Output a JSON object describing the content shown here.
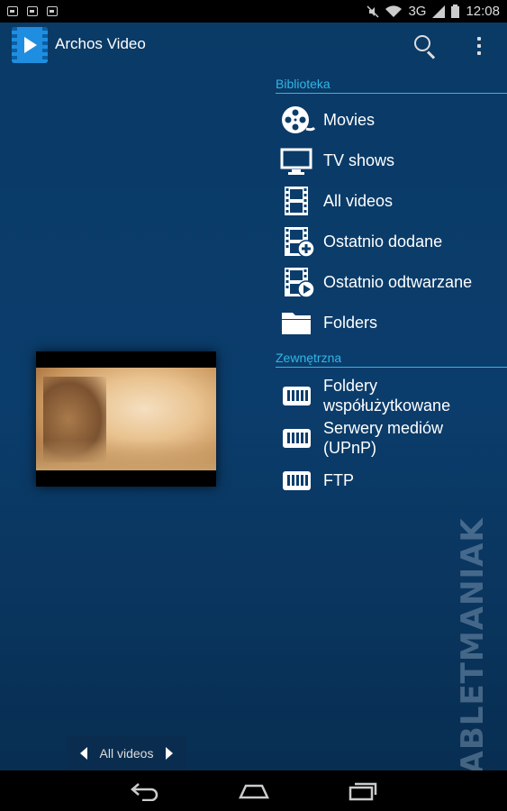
{
  "status_bar": {
    "network": "3G",
    "time": "12:08"
  },
  "action_bar": {
    "title": "Archos Video",
    "logo_icon": "archos-video-logo-icon",
    "search_icon": "search-icon",
    "overflow_icon": "overflow-menu-icon"
  },
  "sections": {
    "library": {
      "header": "Biblioteka",
      "items": [
        {
          "label": "Movies",
          "icon": "film-reel-icon"
        },
        {
          "label": "TV shows",
          "icon": "tv-icon"
        },
        {
          "label": "All videos",
          "icon": "film-strip-icon"
        },
        {
          "label": "Ostatnio dodane",
          "icon": "film-add-icon"
        },
        {
          "label": "Ostatnio odtwarzane",
          "icon": "film-play-icon"
        },
        {
          "label": "Folders",
          "icon": "folder-icon"
        }
      ]
    },
    "external": {
      "header": "Zewnętrzna",
      "items": [
        {
          "label_line1": "Foldery",
          "label_line2": "współużytkowane",
          "icon": "network-storage-icon"
        },
        {
          "label_line1": "Serwery mediów",
          "label_line2": "(UPnP)",
          "icon": "network-storage-icon"
        },
        {
          "label_line1": "FTP",
          "label_line2": "",
          "icon": "network-storage-icon"
        }
      ]
    }
  },
  "pager": {
    "label": "All videos",
    "prev_icon": "chevron-left-icon",
    "next_icon": "chevron-right-icon"
  },
  "watermark": "TABLETMANIAK",
  "nav_bar": {
    "back_icon": "back-icon",
    "home_icon": "home-icon",
    "recents_icon": "recent-apps-icon"
  },
  "colors": {
    "accent": "#33b5e5",
    "background_top": "#0a3a66",
    "background_bottom": "#082e52"
  }
}
